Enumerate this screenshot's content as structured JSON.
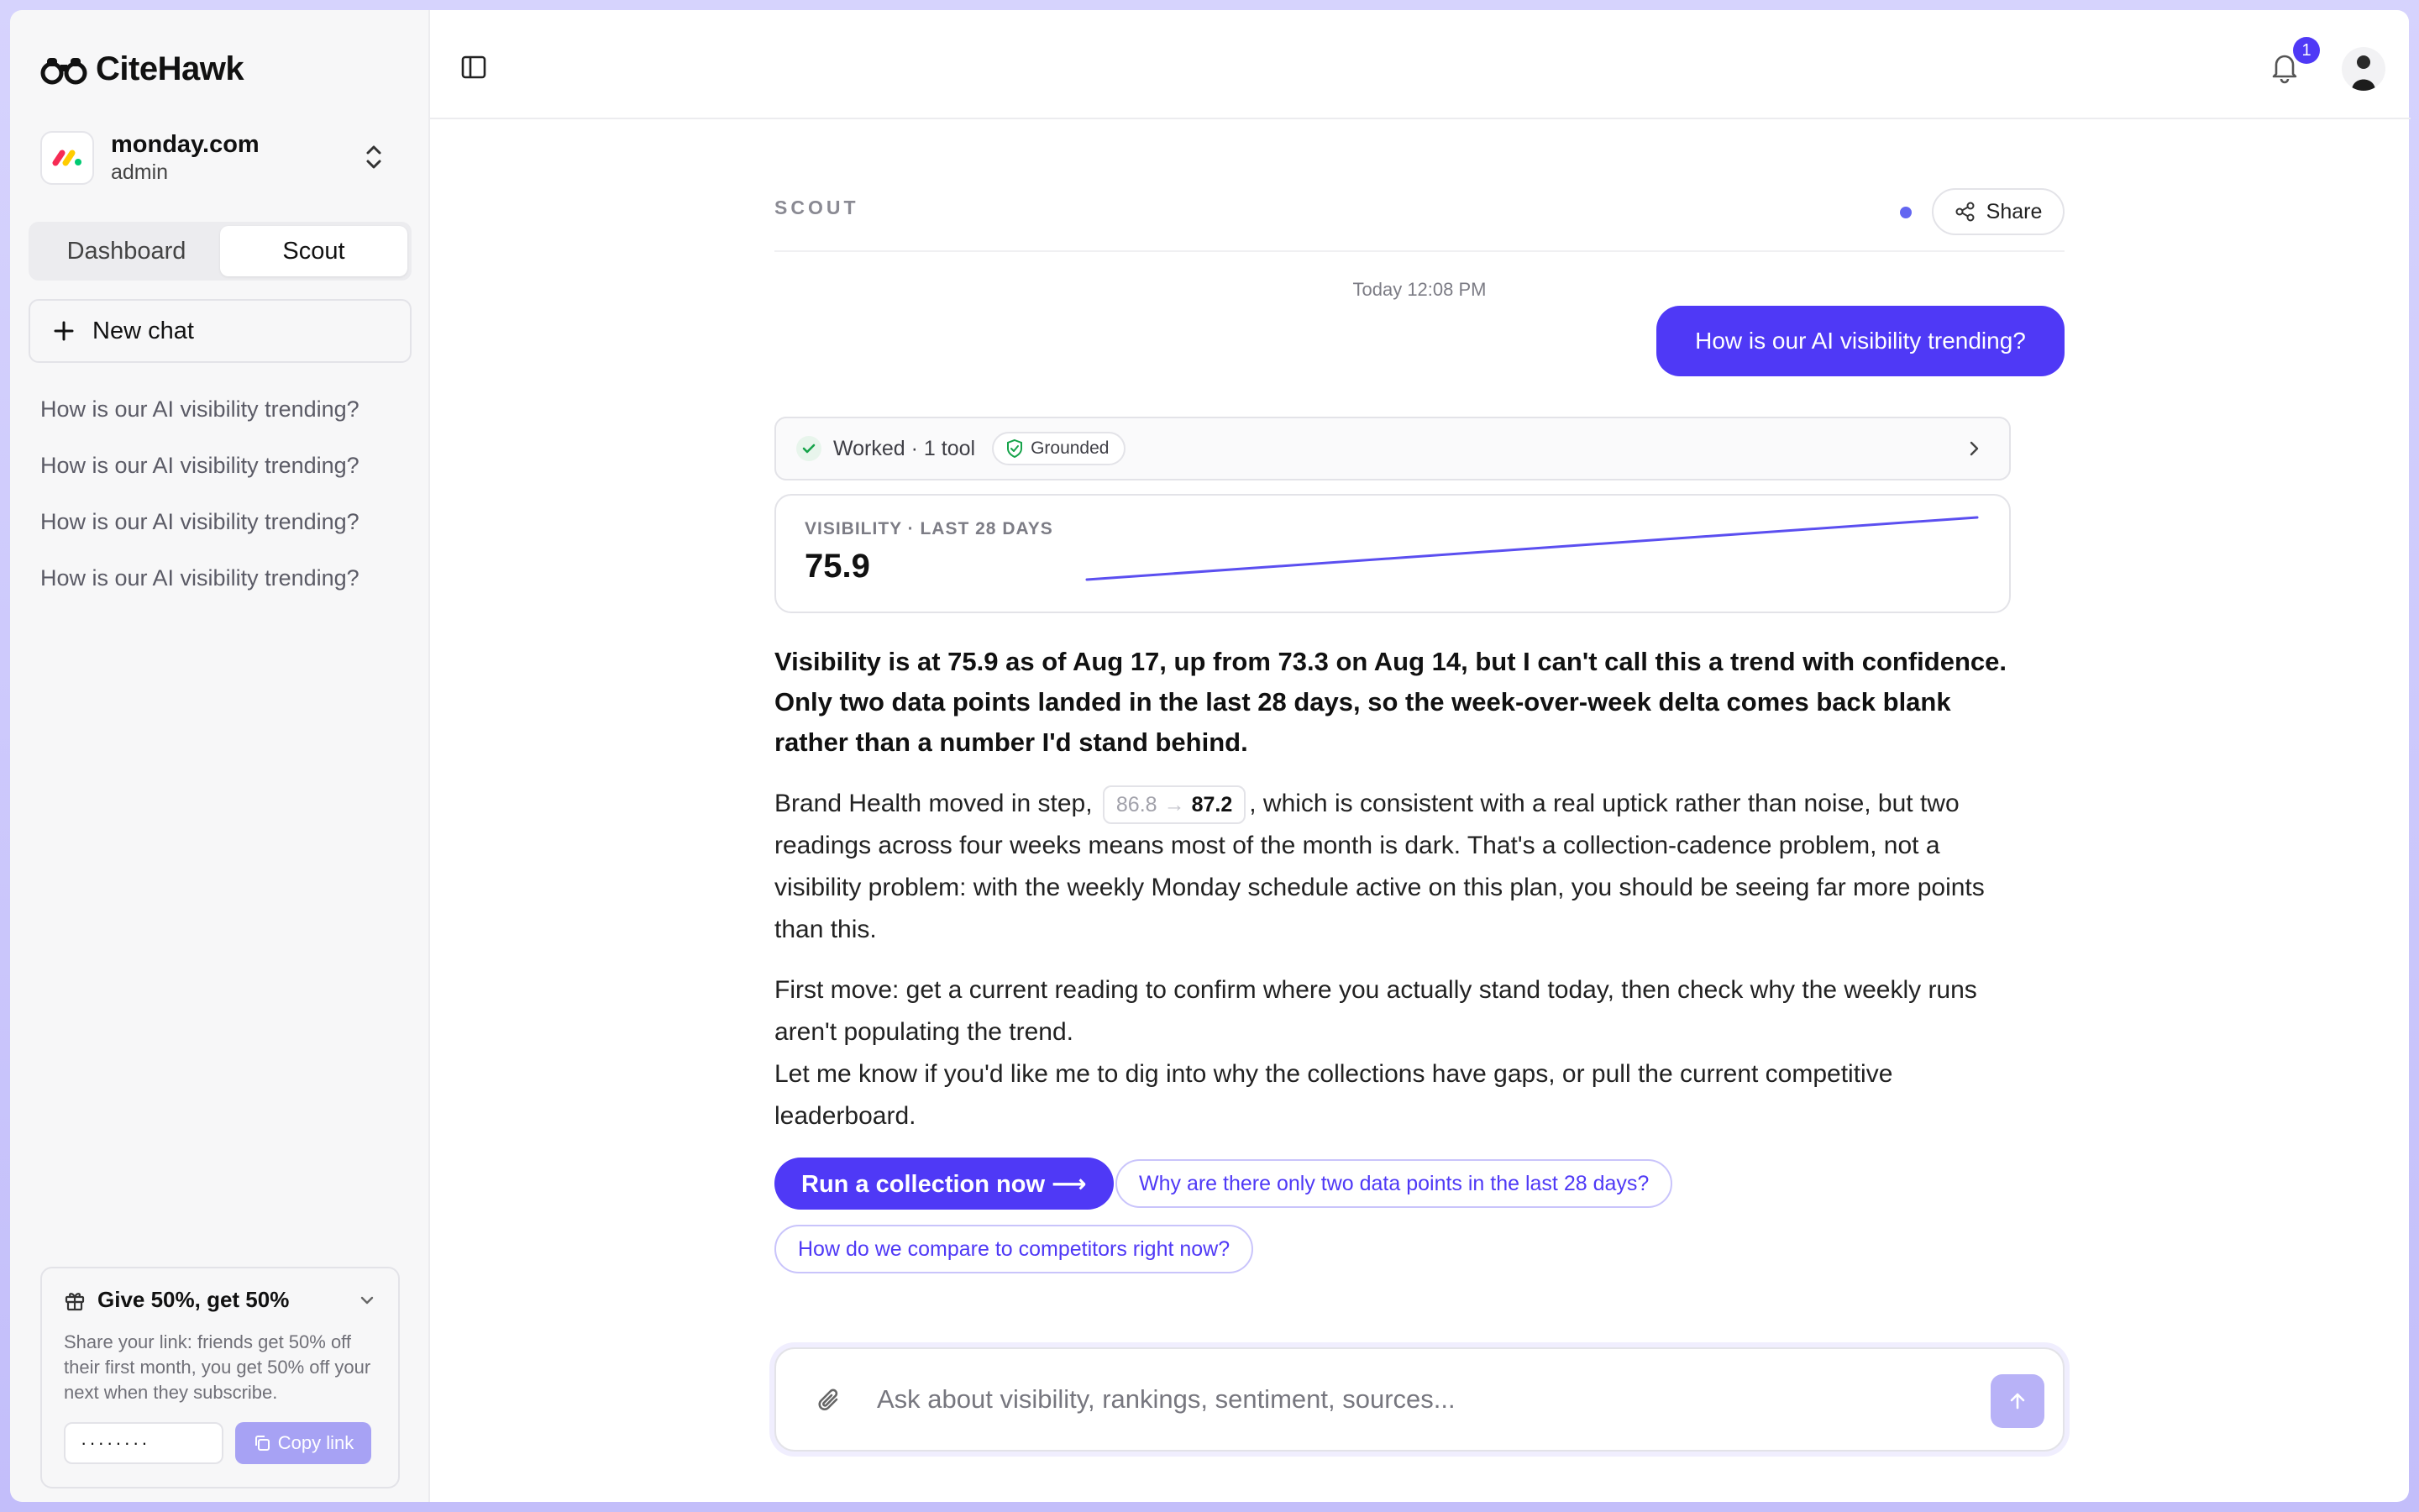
{
  "app": {
    "name": "CiteHawk"
  },
  "org": {
    "name": "monday.com",
    "role": "admin"
  },
  "sidebar": {
    "tabs": [
      {
        "label": "Dashboard",
        "active": false
      },
      {
        "label": "Scout",
        "active": true
      }
    ],
    "new_chat_label": "New chat",
    "history": [
      "How is our AI visibility trending?",
      "How is our AI visibility trending?",
      "How is our AI visibility trending?",
      "How is our AI visibility trending?"
    ],
    "promo": {
      "title": "Give 50%, get 50%",
      "description": "Share your link: friends get 50% off their first month, you get 50% off your next when they subscribe.",
      "link_value": "········",
      "copy_label": "Copy link"
    }
  },
  "topbar": {
    "notification_count": "1"
  },
  "chat": {
    "section_label": "SCOUT",
    "share_label": "Share",
    "timestamp": "Today 12:08 PM",
    "user_message": "How is our AI visibility trending?",
    "tool": {
      "summary": "Worked · 1 tool",
      "badge": "Grounded"
    },
    "metric": {
      "label": "VISIBILITY · LAST 28 DAYS",
      "value": "75.9",
      "series": [
        73.3,
        75.9
      ]
    },
    "answer_bold": "Visibility is at 75.9 as of Aug 17, up from 73.3 on Aug 14, but I can't call this a trend with confidence. Only two data points landed in the last 28 days, so the week-over-week delta comes back blank rather than a number I'd stand behind.",
    "p1_before": "Brand Health moved in step,",
    "delta": {
      "from": "86.8",
      "arrow": "→",
      "to": "87.2"
    },
    "p1_after": ", which is consistent with a real uptick rather than noise, but two readings across four weeks means most of the month is dark. That's a collection-cadence problem, not a visibility problem: with the weekly Monday schedule active on this plan, you should be seeing far more points than this.",
    "p2_line1": "First move: get a current reading to confirm where you actually stand today, then check why the weekly runs aren't populating the trend.",
    "p2_line2": "Let me know if you'd like me to dig into why the collections have gaps, or pull the current competitive leaderboard.",
    "primary_action": "Run a collection now ⟶",
    "suggestions": [
      "Why are there only two data points in the last 28 days?",
      "How do we compare to competitors right now?"
    ],
    "composer_placeholder": "Ask about visibility, rankings, sentiment, sources..."
  },
  "colors": {
    "accent": "#4f39f6",
    "sparkline": "#5b4ff0"
  }
}
